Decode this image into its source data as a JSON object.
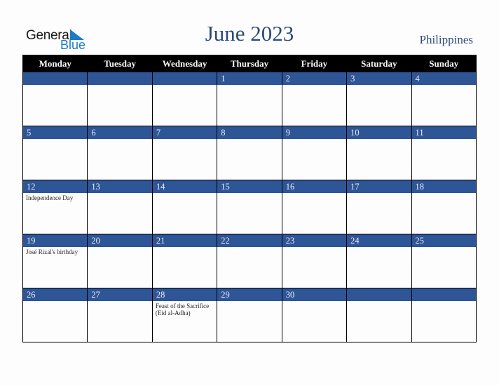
{
  "logo": {
    "general": "General",
    "blue": "Blue"
  },
  "title": "June 2023",
  "country": "Philippines",
  "weekdays": [
    "Monday",
    "Tuesday",
    "Wednesday",
    "Thursday",
    "Friday",
    "Saturday",
    "Sunday"
  ],
  "weeks": [
    [
      {
        "day": "",
        "event": ""
      },
      {
        "day": "",
        "event": ""
      },
      {
        "day": "",
        "event": ""
      },
      {
        "day": "1",
        "event": ""
      },
      {
        "day": "2",
        "event": ""
      },
      {
        "day": "3",
        "event": ""
      },
      {
        "day": "4",
        "event": ""
      }
    ],
    [
      {
        "day": "5",
        "event": ""
      },
      {
        "day": "6",
        "event": ""
      },
      {
        "day": "7",
        "event": ""
      },
      {
        "day": "8",
        "event": ""
      },
      {
        "day": "9",
        "event": ""
      },
      {
        "day": "10",
        "event": ""
      },
      {
        "day": "11",
        "event": ""
      }
    ],
    [
      {
        "day": "12",
        "event": "Independence Day"
      },
      {
        "day": "13",
        "event": ""
      },
      {
        "day": "14",
        "event": ""
      },
      {
        "day": "15",
        "event": ""
      },
      {
        "day": "16",
        "event": ""
      },
      {
        "day": "17",
        "event": ""
      },
      {
        "day": "18",
        "event": ""
      }
    ],
    [
      {
        "day": "19",
        "event": "José Rizal's birthday"
      },
      {
        "day": "20",
        "event": ""
      },
      {
        "day": "21",
        "event": ""
      },
      {
        "day": "22",
        "event": ""
      },
      {
        "day": "23",
        "event": ""
      },
      {
        "day": "24",
        "event": ""
      },
      {
        "day": "25",
        "event": ""
      }
    ],
    [
      {
        "day": "26",
        "event": ""
      },
      {
        "day": "27",
        "event": ""
      },
      {
        "day": "28",
        "event": "Feast of the Sacrifice (Eid al-Adha)"
      },
      {
        "day": "29",
        "event": ""
      },
      {
        "day": "30",
        "event": ""
      },
      {
        "day": "",
        "event": ""
      },
      {
        "day": "",
        "event": ""
      }
    ]
  ],
  "colors": {
    "header_bg": "#000000",
    "band_bg": "#2e5596",
    "title": "#2c4a7a",
    "logo_blue": "#1e7bc6"
  }
}
